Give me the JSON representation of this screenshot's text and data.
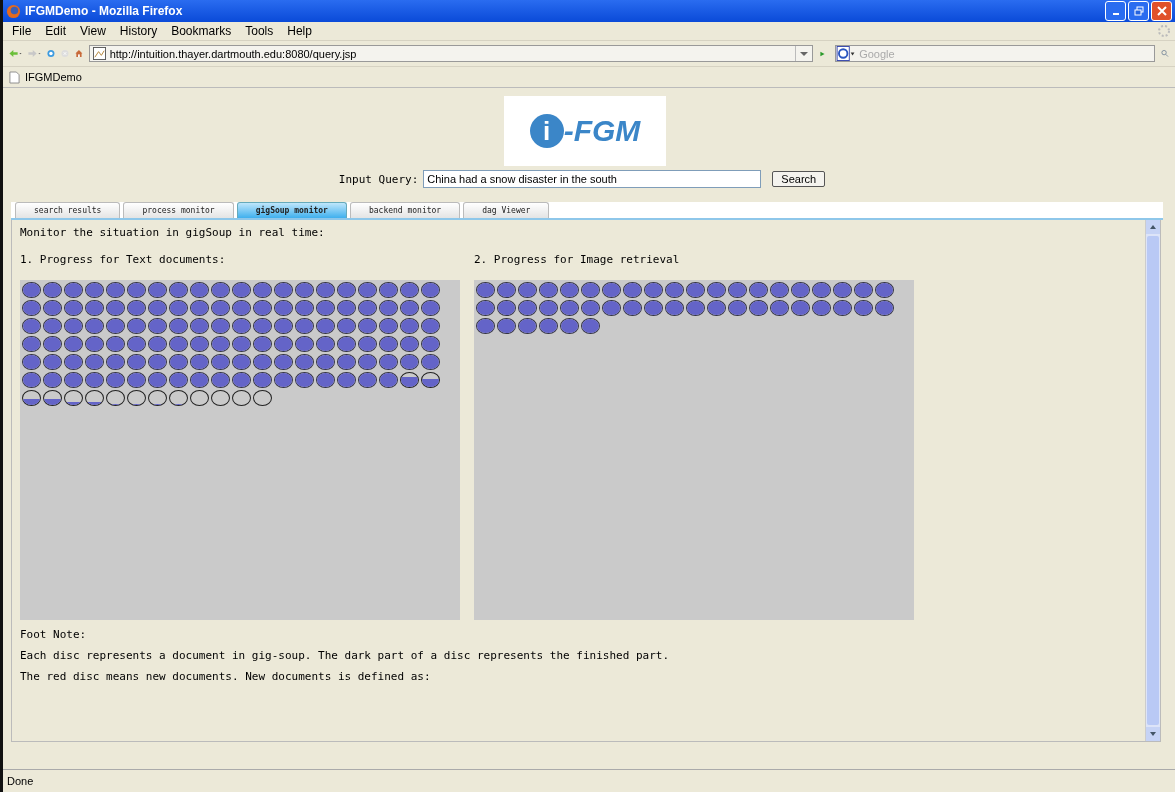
{
  "window": {
    "title": "IFGMDemo - Mozilla Firefox"
  },
  "menu": [
    "File",
    "Edit",
    "View",
    "History",
    "Bookmarks",
    "Tools",
    "Help"
  ],
  "address": "http://intuition.thayer.dartmouth.edu:8080/query.jsp",
  "search_engine": {
    "placeholder": "Google"
  },
  "bookmarks": [
    "IFGMDemo"
  ],
  "logo": {
    "mark": "i",
    "text": "-FGM"
  },
  "query": {
    "label": "Input Query:",
    "value": "China had a snow disaster in the south",
    "button": "Search"
  },
  "tabs": [
    {
      "label": "search results",
      "selected": false
    },
    {
      "label": "process monitor",
      "selected": false
    },
    {
      "label": "gigSoup monitor",
      "selected": true
    },
    {
      "label": "backend monitor",
      "selected": false
    },
    {
      "label": "dag Viewer",
      "selected": false
    }
  ],
  "intro": "Monitor the situation in gigSoup in real time:",
  "panels": [
    {
      "heading": "1. Progress for Text documents:",
      "discs": [
        {
          "kind": "full"
        },
        {
          "kind": "full"
        },
        {
          "kind": "full"
        },
        {
          "kind": "full"
        },
        {
          "kind": "full"
        },
        {
          "kind": "full"
        },
        {
          "kind": "full"
        },
        {
          "kind": "full"
        },
        {
          "kind": "full"
        },
        {
          "kind": "full"
        },
        {
          "kind": "full"
        },
        {
          "kind": "full"
        },
        {
          "kind": "full"
        },
        {
          "kind": "full"
        },
        {
          "kind": "full"
        },
        {
          "kind": "full"
        },
        {
          "kind": "full"
        },
        {
          "kind": "full"
        },
        {
          "kind": "full"
        },
        {
          "kind": "full"
        },
        {
          "kind": "full"
        },
        {
          "kind": "full"
        },
        {
          "kind": "full"
        },
        {
          "kind": "full"
        },
        {
          "kind": "full"
        },
        {
          "kind": "full"
        },
        {
          "kind": "full"
        },
        {
          "kind": "full"
        },
        {
          "kind": "full"
        },
        {
          "kind": "full"
        },
        {
          "kind": "full"
        },
        {
          "kind": "full"
        },
        {
          "kind": "full"
        },
        {
          "kind": "full"
        },
        {
          "kind": "full"
        },
        {
          "kind": "full"
        },
        {
          "kind": "full"
        },
        {
          "kind": "full"
        },
        {
          "kind": "full"
        },
        {
          "kind": "full"
        },
        {
          "kind": "full"
        },
        {
          "kind": "full"
        },
        {
          "kind": "full"
        },
        {
          "kind": "full"
        },
        {
          "kind": "full"
        },
        {
          "kind": "full"
        },
        {
          "kind": "full"
        },
        {
          "kind": "full"
        },
        {
          "kind": "full"
        },
        {
          "kind": "full"
        },
        {
          "kind": "full"
        },
        {
          "kind": "full"
        },
        {
          "kind": "full"
        },
        {
          "kind": "full"
        },
        {
          "kind": "full"
        },
        {
          "kind": "full"
        },
        {
          "kind": "full"
        },
        {
          "kind": "full"
        },
        {
          "kind": "full"
        },
        {
          "kind": "full"
        },
        {
          "kind": "full"
        },
        {
          "kind": "full"
        },
        {
          "kind": "full"
        },
        {
          "kind": "full"
        },
        {
          "kind": "full"
        },
        {
          "kind": "full"
        },
        {
          "kind": "full"
        },
        {
          "kind": "full"
        },
        {
          "kind": "full"
        },
        {
          "kind": "full"
        },
        {
          "kind": "full"
        },
        {
          "kind": "full"
        },
        {
          "kind": "full"
        },
        {
          "kind": "full"
        },
        {
          "kind": "full"
        },
        {
          "kind": "full"
        },
        {
          "kind": "full"
        },
        {
          "kind": "full"
        },
        {
          "kind": "full"
        },
        {
          "kind": "full"
        },
        {
          "kind": "full"
        },
        {
          "kind": "full"
        },
        {
          "kind": "full"
        },
        {
          "kind": "full"
        },
        {
          "kind": "full"
        },
        {
          "kind": "full"
        },
        {
          "kind": "full"
        },
        {
          "kind": "full"
        },
        {
          "kind": "full"
        },
        {
          "kind": "full"
        },
        {
          "kind": "full"
        },
        {
          "kind": "full"
        },
        {
          "kind": "full"
        },
        {
          "kind": "full"
        },
        {
          "kind": "full"
        },
        {
          "kind": "full"
        },
        {
          "kind": "full"
        },
        {
          "kind": "full"
        },
        {
          "kind": "full"
        },
        {
          "kind": "full"
        },
        {
          "kind": "full"
        },
        {
          "kind": "full"
        },
        {
          "kind": "full"
        },
        {
          "kind": "full"
        },
        {
          "kind": "full"
        },
        {
          "kind": "full"
        },
        {
          "kind": "full"
        },
        {
          "kind": "full"
        },
        {
          "kind": "full"
        },
        {
          "kind": "full"
        },
        {
          "kind": "full"
        },
        {
          "kind": "full"
        },
        {
          "kind": "full"
        },
        {
          "kind": "full"
        },
        {
          "kind": "full"
        },
        {
          "kind": "full"
        },
        {
          "kind": "full"
        },
        {
          "kind": "full"
        },
        {
          "kind": "most"
        },
        {
          "kind": "more"
        },
        {
          "kind": "half"
        },
        {
          "kind": "half"
        },
        {
          "kind": "some"
        },
        {
          "kind": "some"
        },
        {
          "kind": "little"
        },
        {
          "kind": "little"
        },
        {
          "kind": "little"
        },
        {
          "kind": "little"
        },
        {
          "kind": "empty"
        },
        {
          "kind": "empty"
        },
        {
          "kind": "empty"
        },
        {
          "kind": "empty"
        }
      ]
    },
    {
      "heading": "2. Progress for Image retrieval",
      "discs": [
        {
          "kind": "full"
        },
        {
          "kind": "full"
        },
        {
          "kind": "full"
        },
        {
          "kind": "full"
        },
        {
          "kind": "full"
        },
        {
          "kind": "full"
        },
        {
          "kind": "full"
        },
        {
          "kind": "full"
        },
        {
          "kind": "full"
        },
        {
          "kind": "full"
        },
        {
          "kind": "full"
        },
        {
          "kind": "full"
        },
        {
          "kind": "full"
        },
        {
          "kind": "full"
        },
        {
          "kind": "full"
        },
        {
          "kind": "full"
        },
        {
          "kind": "full"
        },
        {
          "kind": "full"
        },
        {
          "kind": "full"
        },
        {
          "kind": "full"
        },
        {
          "kind": "full"
        },
        {
          "kind": "full"
        },
        {
          "kind": "full"
        },
        {
          "kind": "full"
        },
        {
          "kind": "full"
        },
        {
          "kind": "full"
        },
        {
          "kind": "full"
        },
        {
          "kind": "full"
        },
        {
          "kind": "full"
        },
        {
          "kind": "full"
        },
        {
          "kind": "full"
        },
        {
          "kind": "full"
        },
        {
          "kind": "full"
        },
        {
          "kind": "full"
        },
        {
          "kind": "full"
        },
        {
          "kind": "full"
        },
        {
          "kind": "full"
        },
        {
          "kind": "full"
        },
        {
          "kind": "full"
        },
        {
          "kind": "full"
        },
        {
          "kind": "full"
        },
        {
          "kind": "full"
        },
        {
          "kind": "full"
        },
        {
          "kind": "full"
        },
        {
          "kind": "full"
        },
        {
          "kind": "full"
        }
      ]
    }
  ],
  "footnote": {
    "title": "Foot Note:",
    "lines": [
      "Each disc represents a document in gig-soup. The dark part of a disc represents the finished part.",
      "The red disc means new documents. New documents is defined as:"
    ]
  },
  "status_bar": "Done"
}
